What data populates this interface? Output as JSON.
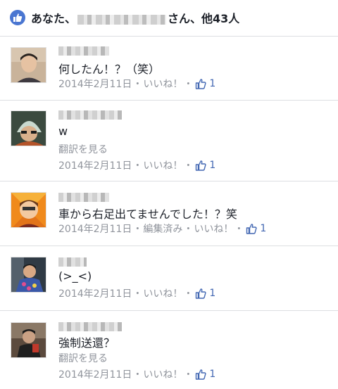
{
  "likes_header": {
    "prefix": "あなた、",
    "suffix": "さん、他43人"
  },
  "comments": [
    {
      "text": "何したん！？（笑）",
      "translate": "",
      "date": "2014年2月11日",
      "edited": "",
      "like_label": "いいね！",
      "like_count": "1"
    },
    {
      "text": "w",
      "translate": "翻訳を見る",
      "date": "2014年2月11日",
      "edited": "",
      "like_label": "いいね！",
      "like_count": "1"
    },
    {
      "text": "車から右足出てませんでした！？笑",
      "translate": "",
      "date": "2014年2月11日",
      "edited": "編集済み",
      "like_label": "いいね！",
      "like_count": "1"
    },
    {
      "text": "(>_<)",
      "translate": "",
      "date": "2014年2月11日",
      "edited": "",
      "like_label": "いいね！",
      "like_count": "1"
    },
    {
      "text": "強制送還？",
      "translate": "翻訳を見る",
      "date": "2014年2月11日",
      "edited": "",
      "like_label": "いいね！",
      "like_count": "1"
    }
  ],
  "separator": "・",
  "colors": {
    "accent": "#4267b2",
    "meta_gray": "#90949c",
    "divider": "#dddfe2"
  },
  "icons": {
    "header": "like-thumb-circle-icon",
    "inline": "thumb-up-outline-icon"
  }
}
